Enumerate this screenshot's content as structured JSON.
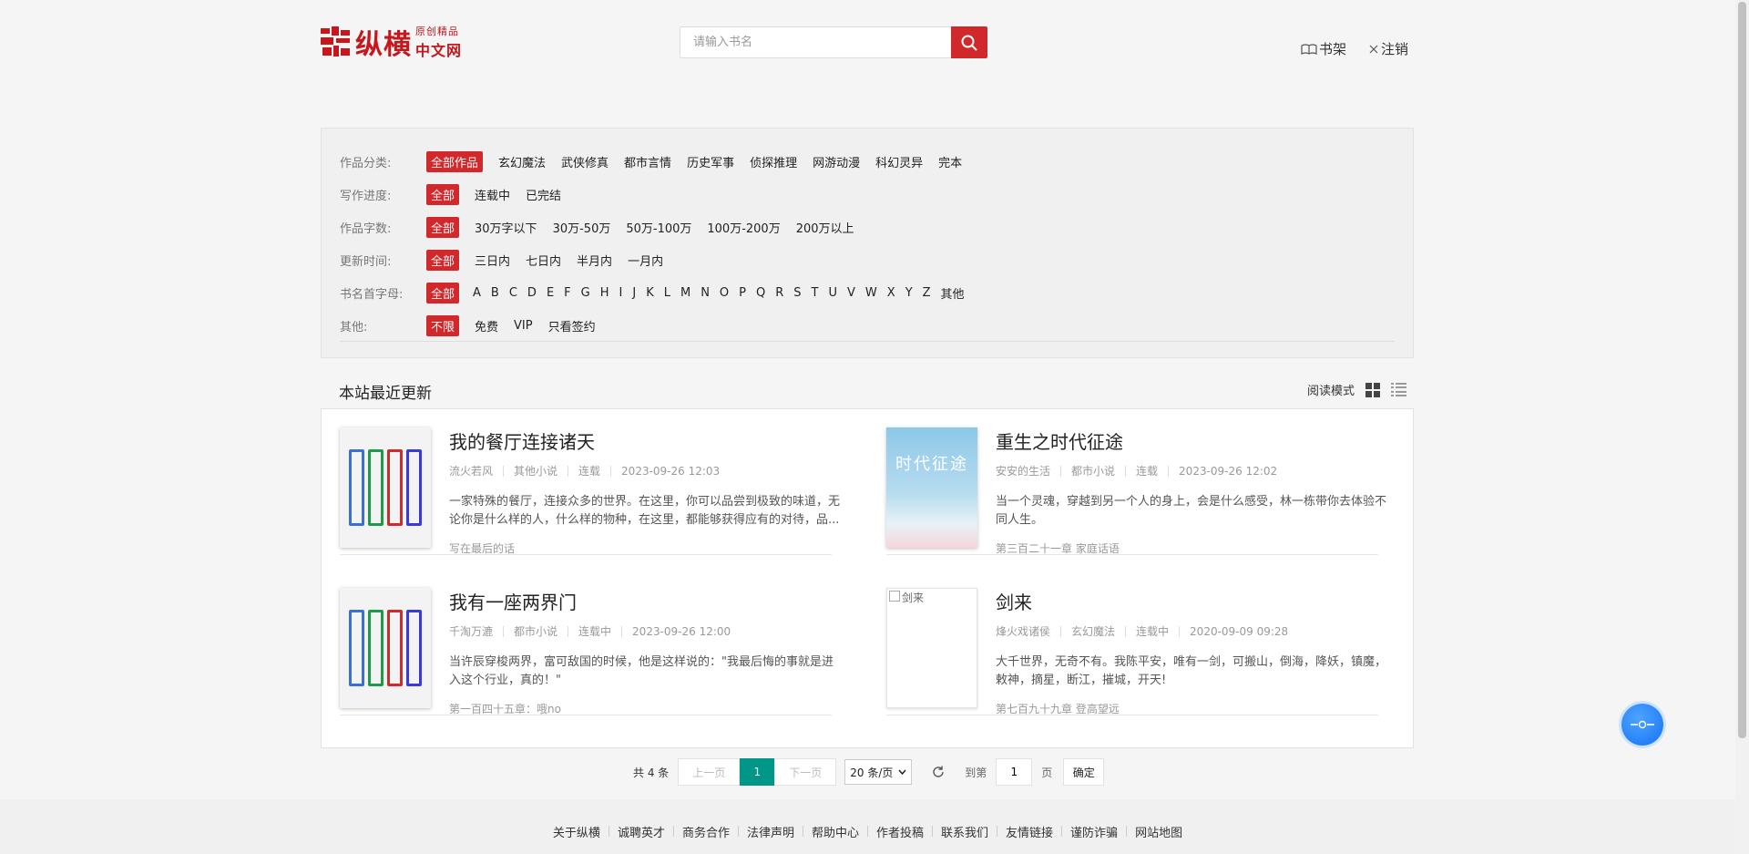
{
  "header": {
    "logo_main": "纵横",
    "logo_sub_top": "原创精品",
    "logo_sub_bottom": "中文网",
    "search_placeholder": "请输入书名",
    "links": [
      "书架",
      "注销"
    ]
  },
  "filters": [
    {
      "label": "作品分类:",
      "options": [
        "全部作品",
        "玄幻魔法",
        "武侠修真",
        "都市言情",
        "历史军事",
        "侦探推理",
        "网游动漫",
        "科幻灵异",
        "完本"
      ],
      "active": 0
    },
    {
      "label": "写作进度:",
      "options": [
        "全部",
        "连载中",
        "已完结"
      ],
      "active": 0
    },
    {
      "label": "作品字数:",
      "options": [
        "全部",
        "30万字以下",
        "30万-50万",
        "50万-100万",
        "100万-200万",
        "200万以上"
      ],
      "active": 0
    },
    {
      "label": "更新时间:",
      "options": [
        "全部",
        "三日内",
        "七日内",
        "半月内",
        "一月内"
      ],
      "active": 0
    },
    {
      "label": "书名首字母:",
      "options": [
        "全部",
        "A",
        "B",
        "C",
        "D",
        "E",
        "F",
        "G",
        "H",
        "I",
        "J",
        "K",
        "L",
        "M",
        "N",
        "O",
        "P",
        "Q",
        "R",
        "S",
        "T",
        "U",
        "V",
        "W",
        "X",
        "Y",
        "Z",
        "其他"
      ],
      "active": 0
    },
    {
      "label": "其他:",
      "options": [
        "不限",
        "免费",
        "VIP",
        "只看签约"
      ],
      "active": 0
    }
  ],
  "section": {
    "title": "本站最近更新",
    "mode_label": "阅读模式"
  },
  "books": [
    {
      "title": "我的餐厅连接诸天",
      "author": "流火若风",
      "category": "其他小说",
      "status": "连载",
      "updated": "2023-09-26 12:03",
      "desc": "一家特殊的餐厅，连接众多的世界。在这里，你可以品尝到极致的味道，无论你是什么样的人，什么样的物种，在这里，都能够获得应有的对待，品...",
      "latest": "写在最后的话",
      "cover": "pattern"
    },
    {
      "title": "重生之时代征途",
      "author": "安安的生活",
      "category": "都市小说",
      "status": "连载",
      "updated": "2023-09-26 12:02",
      "desc": "当一个灵魂，穿越到另一个人的身上，会是什么感受，林一栋带你去体验不同人生。",
      "latest": "第三百二十一章 家庭话语",
      "cover": "sky",
      "cover_text": "时代征途"
    },
    {
      "title": "我有一座两界门",
      "author": "千淘万漉",
      "category": "都市小说",
      "status": "连载中",
      "updated": "2023-09-26 12:00",
      "desc": "当许辰穿梭两界，富可敌国的时候，他是这样说的：\"我最后悔的事就是进入这个行业，真的！\"",
      "latest": "第一百四十五章：哦no",
      "cover": "pattern"
    },
    {
      "title": "剑来",
      "author": "烽火戏诸侯",
      "category": "玄幻魔法",
      "status": "连载中",
      "updated": "2020-09-09 09:28",
      "desc": "大千世界，无奇不有。我陈平安，唯有一剑，可搬山，倒海，降妖，镇魔，敕神，摘星，断江，摧城，开天!",
      "latest": "第七百九十九章 登高望远",
      "cover": "broken",
      "cover_alt": "剑来"
    }
  ],
  "pager": {
    "total": "共 4 条",
    "prev": "上一页",
    "current": "1",
    "next": "下一页",
    "size": "20 条/页",
    "goto_label": "到第",
    "goto_value": "1",
    "page_unit": "页",
    "ok": "确定"
  },
  "footer": [
    "关于纵横",
    "诚聘英才",
    "商务合作",
    "法律声明",
    "帮助中心",
    "作者投稿",
    "联系我们",
    "友情链接",
    "谨防诈骗",
    "网站地图"
  ],
  "colors": {
    "brand_red": "#d0282b",
    "pager_active": "#009688",
    "float_blue": "#1572f5"
  }
}
